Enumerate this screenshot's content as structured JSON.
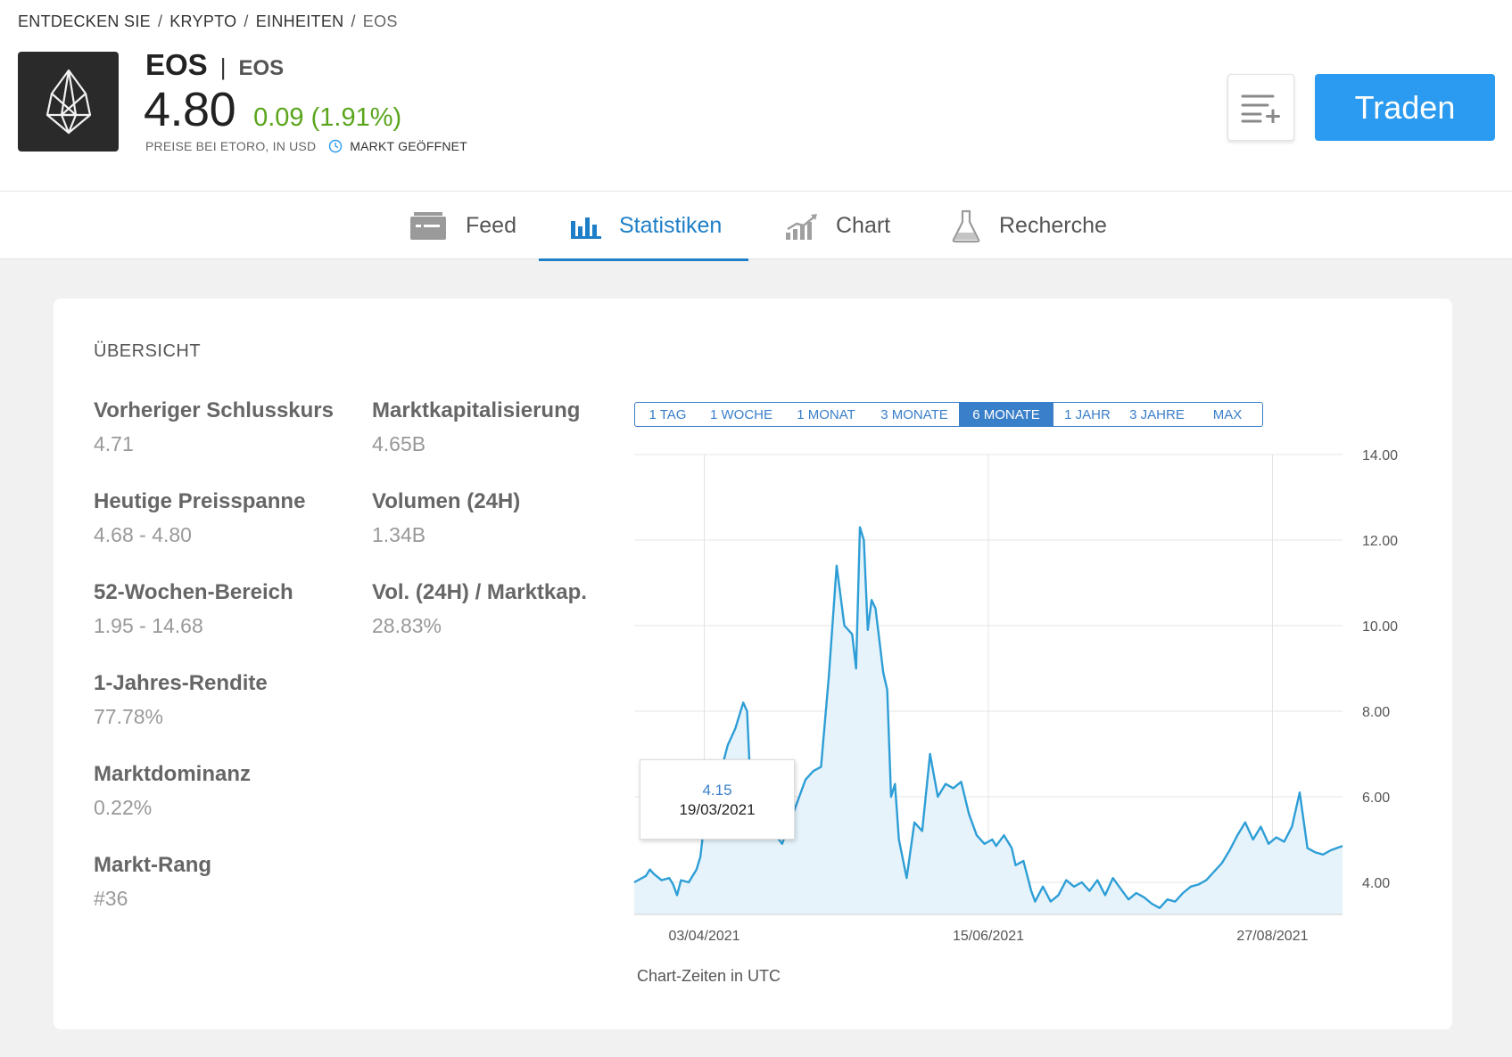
{
  "breadcrumb": [
    "ENTDECKEN SIE",
    "KRYPTO",
    "EINHEITEN",
    "EOS"
  ],
  "asset": {
    "ticker": "EOS",
    "name": "EOS",
    "price": "4.80",
    "change": "0.09 (1.91%)",
    "prices_note": "PREISE BEI ETORO, IN USD",
    "market_status": "MARKT GEÖFFNET"
  },
  "actions": {
    "trade_label": "Traden"
  },
  "tabs": [
    {
      "label": "Feed",
      "icon": "feed-icon"
    },
    {
      "label": "Statistiken",
      "icon": "bar-chart-icon",
      "active": true
    },
    {
      "label": "Chart",
      "icon": "trend-chart-icon"
    },
    {
      "label": "Recherche",
      "icon": "flask-icon"
    }
  ],
  "overview": {
    "heading": "ÜBERSICHT",
    "stats_left": [
      {
        "label": "Vorheriger Schlusskurs",
        "value": "4.71"
      },
      {
        "label": "Heutige Preisspanne",
        "value": "4.68 - 4.80"
      },
      {
        "label": "52-Wochen-Bereich",
        "value": "1.95 - 14.68"
      },
      {
        "label": "1-Jahres-Rendite",
        "value": "77.78%"
      },
      {
        "label": "Marktdominanz",
        "value": "0.22%"
      },
      {
        "label": "Markt-Rang",
        "value": "#36"
      }
    ],
    "stats_right": [
      {
        "label": "Marktkapitalisierung",
        "value": "4.65B"
      },
      {
        "label": "Volumen (24H)",
        "value": "1.34B"
      },
      {
        "label": "Vol. (24H) / Marktkap.",
        "value": "28.83%"
      }
    ]
  },
  "ranges": [
    "1 TAG",
    "1 WOCHE",
    "1 MONAT",
    "3 MONATE",
    "6 MONATE",
    "1 JAHR",
    "3 JAHRE",
    "MAX"
  ],
  "selected_range": "6 MONATE",
  "tooltip": {
    "value": "4.15",
    "date": "19/03/2021"
  },
  "chart_note": "Chart-Zeiten in UTC",
  "colors": {
    "accent": "#2a9bf0",
    "line": "#2e9ed6",
    "area": "#e6f3fb",
    "positive": "#5aa51c"
  },
  "chart_data": {
    "type": "area",
    "y_ticks": [
      "14.00",
      "12.00",
      "10.00",
      "8.00",
      "6.00",
      "4.00"
    ],
    "ylim": [
      3.25,
      14
    ],
    "x_ticks": [
      {
        "label": "03/04/2021",
        "date": "2021-04-03"
      },
      {
        "label": "15/06/2021",
        "date": "2021-06-15"
      },
      {
        "label": "27/08/2021",
        "date": "2021-08-27"
      }
    ],
    "xlim": [
      "2021-03-16",
      "2021-09-14"
    ],
    "grid": true,
    "points": [
      [
        "2021-03-16",
        4.0
      ],
      [
        "2021-03-18",
        4.1
      ],
      [
        "2021-03-19",
        4.15
      ],
      [
        "2021-03-20",
        4.3
      ],
      [
        "2021-03-21",
        4.2
      ],
      [
        "2021-03-23",
        4.05
      ],
      [
        "2021-03-25",
        4.1
      ],
      [
        "2021-03-26",
        3.95
      ],
      [
        "2021-03-27",
        3.7
      ],
      [
        "2021-03-28",
        4.05
      ],
      [
        "2021-03-30",
        4.0
      ],
      [
        "2021-04-01",
        4.3
      ],
      [
        "2021-04-02",
        4.6
      ],
      [
        "2021-04-03",
        5.4
      ],
      [
        "2021-04-05",
        5.6
      ],
      [
        "2021-04-07",
        6.5
      ],
      [
        "2021-04-09",
        7.2
      ],
      [
        "2021-04-11",
        7.6
      ],
      [
        "2021-04-13",
        8.2
      ],
      [
        "2021-04-14",
        8.0
      ],
      [
        "2021-04-15",
        6.0
      ],
      [
        "2021-04-17",
        5.6
      ],
      [
        "2021-04-19",
        5.3
      ],
      [
        "2021-04-21",
        5.15
      ],
      [
        "2021-04-23",
        4.9
      ],
      [
        "2021-04-25",
        5.4
      ],
      [
        "2021-04-27",
        5.9
      ],
      [
        "2021-04-29",
        6.4
      ],
      [
        "2021-05-01",
        6.6
      ],
      [
        "2021-05-03",
        6.7
      ],
      [
        "2021-05-05",
        8.8
      ],
      [
        "2021-05-07",
        11.4
      ],
      [
        "2021-05-09",
        10.0
      ],
      [
        "2021-05-11",
        9.8
      ],
      [
        "2021-05-12",
        9.0
      ],
      [
        "2021-05-13",
        12.3
      ],
      [
        "2021-05-14",
        12.0
      ],
      [
        "2021-05-15",
        9.9
      ],
      [
        "2021-05-16",
        10.6
      ],
      [
        "2021-05-17",
        10.4
      ],
      [
        "2021-05-19",
        8.9
      ],
      [
        "2021-05-20",
        8.5
      ],
      [
        "2021-05-21",
        6.0
      ],
      [
        "2021-05-22",
        6.3
      ],
      [
        "2021-05-23",
        5.0
      ],
      [
        "2021-05-25",
        4.1
      ],
      [
        "2021-05-27",
        5.4
      ],
      [
        "2021-05-29",
        5.2
      ],
      [
        "2021-05-31",
        7.0
      ],
      [
        "2021-06-02",
        6.0
      ],
      [
        "2021-06-04",
        6.3
      ],
      [
        "2021-06-06",
        6.2
      ],
      [
        "2021-06-08",
        6.35
      ],
      [
        "2021-06-10",
        5.6
      ],
      [
        "2021-06-12",
        5.1
      ],
      [
        "2021-06-14",
        4.9
      ],
      [
        "2021-06-16",
        5.0
      ],
      [
        "2021-06-17",
        4.85
      ],
      [
        "2021-06-19",
        5.1
      ],
      [
        "2021-06-21",
        4.8
      ],
      [
        "2021-06-22",
        4.4
      ],
      [
        "2021-06-24",
        4.5
      ],
      [
        "2021-06-26",
        3.8
      ],
      [
        "2021-06-27",
        3.55
      ],
      [
        "2021-06-29",
        3.9
      ],
      [
        "2021-07-01",
        3.55
      ],
      [
        "2021-07-03",
        3.7
      ],
      [
        "2021-07-05",
        4.05
      ],
      [
        "2021-07-07",
        3.9
      ],
      [
        "2021-07-09",
        4.0
      ],
      [
        "2021-07-11",
        3.8
      ],
      [
        "2021-07-13",
        4.05
      ],
      [
        "2021-07-15",
        3.7
      ],
      [
        "2021-07-17",
        4.1
      ],
      [
        "2021-07-19",
        3.85
      ],
      [
        "2021-07-21",
        3.6
      ],
      [
        "2021-07-23",
        3.75
      ],
      [
        "2021-07-25",
        3.65
      ],
      [
        "2021-07-27",
        3.5
      ],
      [
        "2021-07-29",
        3.4
      ],
      [
        "2021-07-31",
        3.6
      ],
      [
        "2021-08-02",
        3.55
      ],
      [
        "2021-08-04",
        3.75
      ],
      [
        "2021-08-06",
        3.9
      ],
      [
        "2021-08-08",
        3.95
      ],
      [
        "2021-08-10",
        4.05
      ],
      [
        "2021-08-12",
        4.25
      ],
      [
        "2021-08-14",
        4.45
      ],
      [
        "2021-08-16",
        4.75
      ],
      [
        "2021-08-18",
        5.1
      ],
      [
        "2021-08-20",
        5.4
      ],
      [
        "2021-08-22",
        5.0
      ],
      [
        "2021-08-24",
        5.3
      ],
      [
        "2021-08-26",
        4.9
      ],
      [
        "2021-08-28",
        5.05
      ],
      [
        "2021-08-30",
        4.95
      ],
      [
        "2021-09-01",
        5.3
      ],
      [
        "2021-09-03",
        6.1
      ],
      [
        "2021-09-05",
        4.8
      ],
      [
        "2021-09-07",
        4.7
      ],
      [
        "2021-09-09",
        4.65
      ],
      [
        "2021-09-11",
        4.75
      ],
      [
        "2021-09-14",
        4.85
      ]
    ]
  }
}
